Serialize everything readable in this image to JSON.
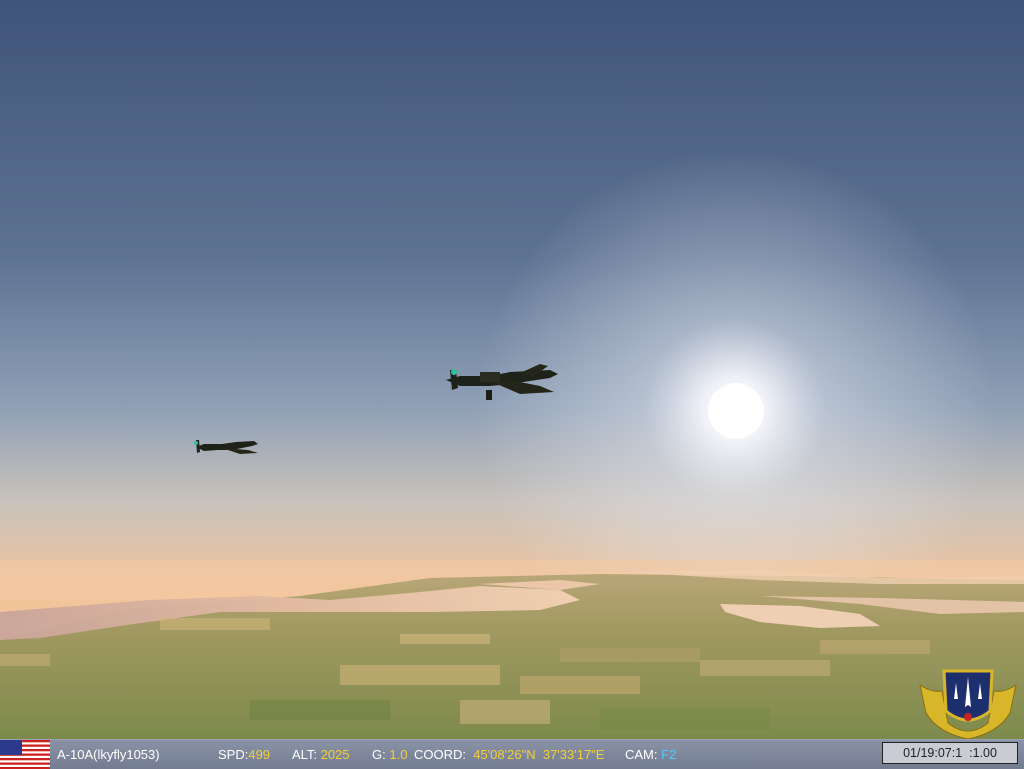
{
  "hud": {
    "aircraft_label": "A-10A(lkyfly1053)",
    "speed_label": "SPD:",
    "speed_value": "499",
    "altitude_label": "ALT:",
    "altitude_value": "2025",
    "g_label": "G:",
    "g_value": "1.0",
    "coord_label": "COORD:",
    "latitude": "45'08'26\"N",
    "longitude": "37'33'17\"E",
    "camera_label": "CAM:",
    "camera_value": "F2",
    "clock": "01/19:07:1  :1.00"
  },
  "colors": {
    "hud_value": "#f2d03a",
    "camera_value": "#58c9ff",
    "status_bar": "#7f8899"
  },
  "icons": {
    "flag": "us-flag-icon",
    "emblem": "squadron-emblem-icon"
  }
}
